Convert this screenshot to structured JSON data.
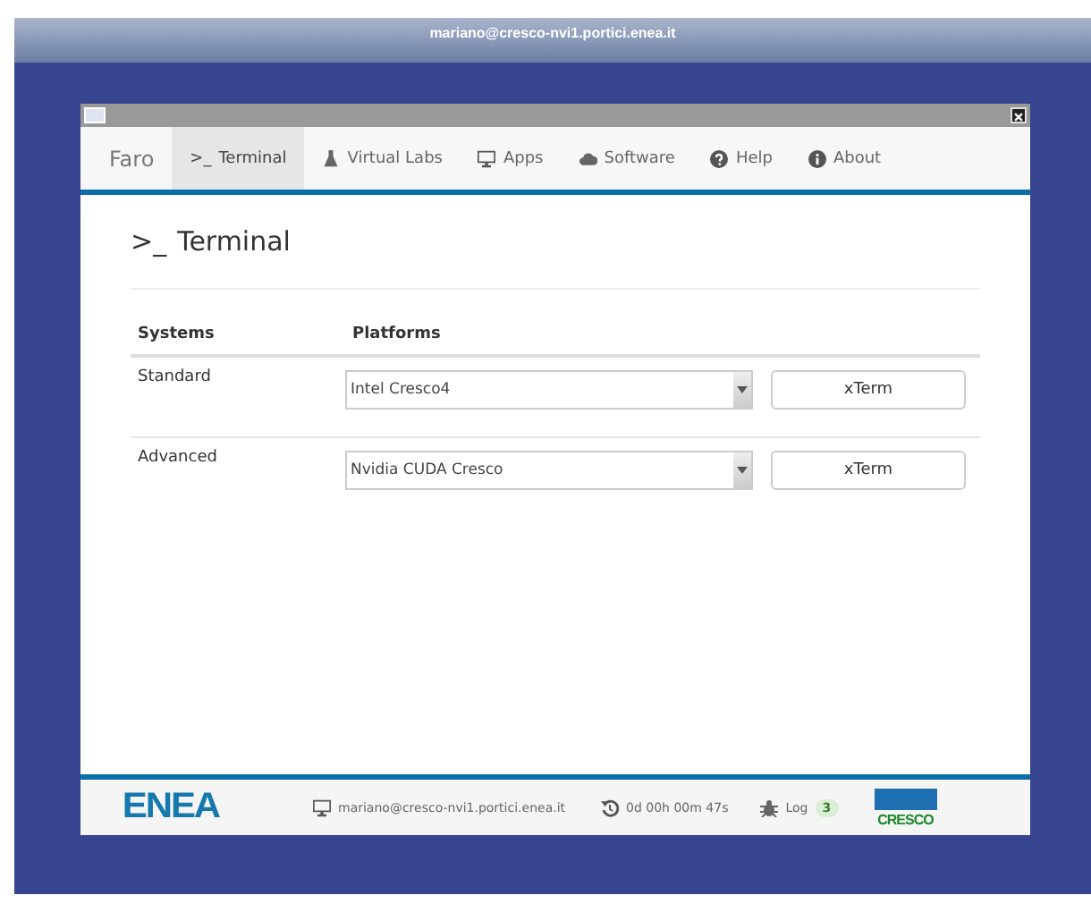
{
  "desktop": {
    "title": "mariano@cresco-nvi1.portici.enea.it"
  },
  "nav": {
    "brand": "Faro",
    "tabs": [
      {
        "kind": "terminal",
        "icon_text": ">_",
        "label": "Terminal",
        "selected": true
      },
      {
        "kind": "flask",
        "label": "Virtual Labs",
        "selected": false
      },
      {
        "kind": "monitor",
        "label": "Apps",
        "selected": false
      },
      {
        "kind": "cloud",
        "label": "Software",
        "selected": false
      },
      {
        "kind": "help",
        "label": "Help",
        "selected": false
      },
      {
        "kind": "info",
        "label": "About",
        "selected": false
      }
    ]
  },
  "page": {
    "title_icon": ">_",
    "title": "Terminal",
    "table": {
      "columns": [
        "Systems",
        "Platforms"
      ],
      "rows": [
        {
          "system": "Standard",
          "platform": "Intel Cresco4",
          "button": "xTerm"
        },
        {
          "system": "Advanced",
          "platform": "Nvidia CUDA Cresco",
          "button": "xTerm"
        }
      ]
    }
  },
  "footer": {
    "logo": "ENEA",
    "user": "mariano@cresco-nvi1.portici.enea.it",
    "uptime": "0d 00h 00m 47s",
    "log_label": "Log",
    "log_count": "3",
    "logo_right": "CRESCO"
  }
}
